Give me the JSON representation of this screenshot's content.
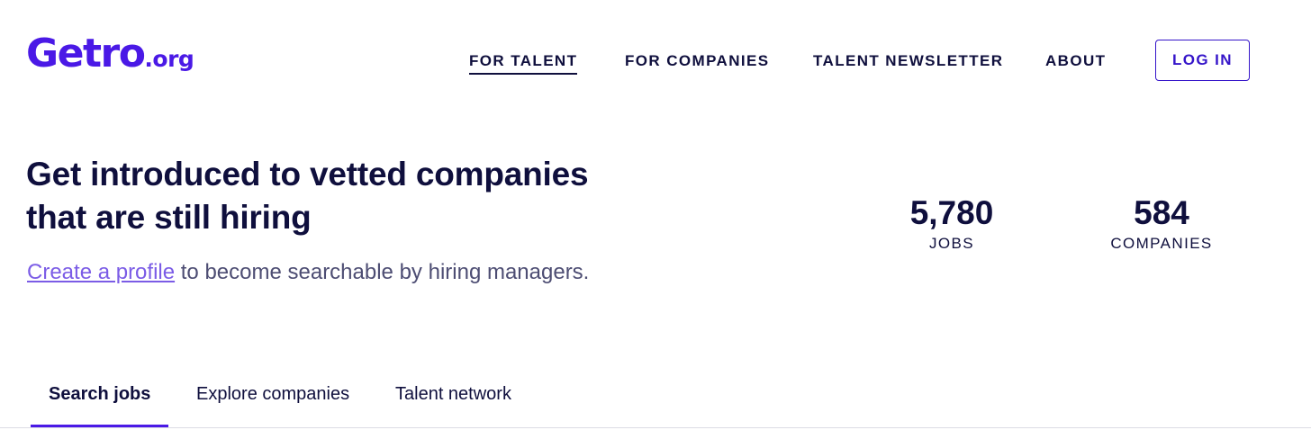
{
  "brand": {
    "name": "Getro",
    "tld": ".org",
    "color": "#4A19E6"
  },
  "nav": {
    "items": [
      {
        "label": "FOR TALENT",
        "active": true
      },
      {
        "label": "FOR COMPANIES",
        "active": false
      },
      {
        "label": "TALENT NEWSLETTER",
        "active": false
      },
      {
        "label": "ABOUT",
        "active": false
      }
    ],
    "login_label": "LOG IN"
  },
  "hero": {
    "title_line1": "Get introduced to vetted companies",
    "title_line2": "that are still hiring",
    "link_text": "Create a profile",
    "subtitle_rest": " to become searchable by hiring managers."
  },
  "stats": [
    {
      "value": "5,780",
      "label": "JOBS"
    },
    {
      "value": "584",
      "label": "COMPANIES"
    }
  ],
  "tabs": [
    {
      "label": "Search jobs",
      "active": true
    },
    {
      "label": "Explore companies",
      "active": false
    },
    {
      "label": "Talent network",
      "active": false
    }
  ],
  "colors": {
    "primary": "#4A19E6",
    "heading": "#0f0f3d",
    "link": "#7b5ce6",
    "muted_text": "#4d4d73"
  }
}
